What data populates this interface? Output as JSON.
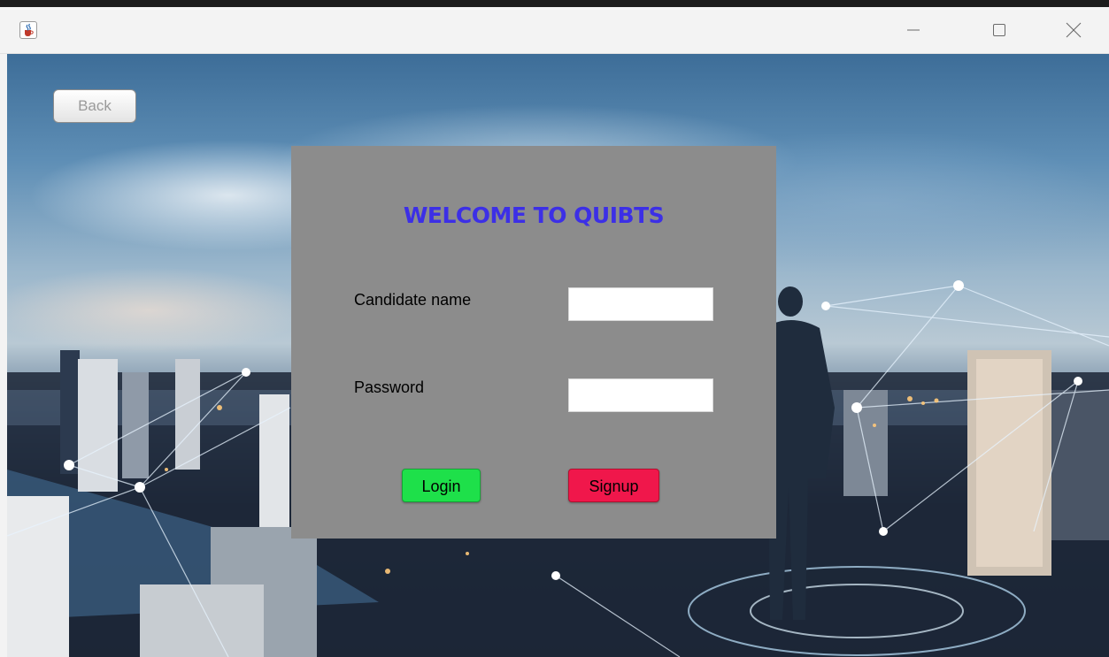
{
  "window": {
    "app_icon": "java-cup-icon",
    "controls": {
      "minimize": "minimize-icon",
      "maximize": "maximize-icon",
      "close": "close-icon"
    }
  },
  "content": {
    "back_label": "Back",
    "panel": {
      "title": "WELCOME TO QUIBTS",
      "candidate_name_label": "Candidate name",
      "candidate_name_value": "",
      "password_label": "Password",
      "password_value": "",
      "login_label": "Login",
      "signup_label": "Signup"
    }
  },
  "colors": {
    "panel_bg": "#8c8c8c",
    "title": "#3c2fe6",
    "login_button": "#1ee04a",
    "signup_button": "#f0174b"
  }
}
